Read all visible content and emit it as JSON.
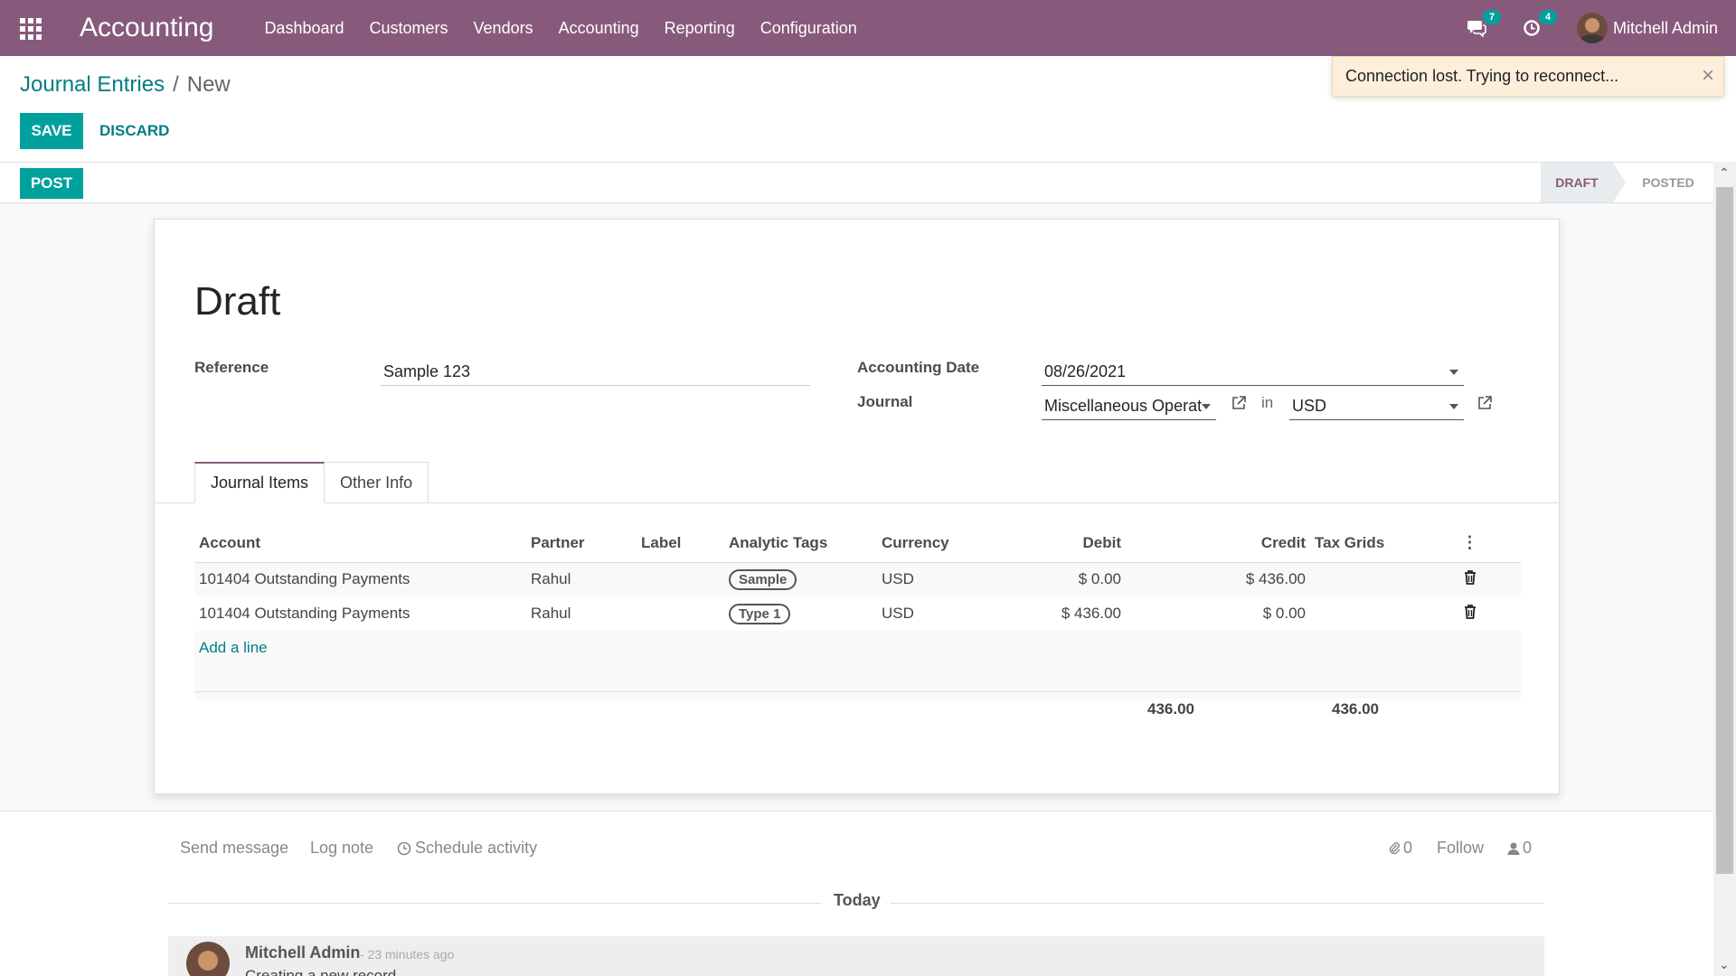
{
  "navbar": {
    "app_name": "Accounting",
    "menu": [
      "Dashboard",
      "Customers",
      "Vendors",
      "Accounting",
      "Reporting",
      "Configuration"
    ],
    "messages_count": "7",
    "activities_count": "4",
    "user_name": "Mitchell Admin"
  },
  "breadcrumb": {
    "parent": "Journal Entries",
    "separator": "/",
    "current": "New"
  },
  "buttons": {
    "save": "SAVE",
    "discard": "DISCARD",
    "post": "POST"
  },
  "notification": {
    "text": "Connection lost. Trying to reconnect...",
    "close": "×"
  },
  "statusbar": {
    "stages": [
      "DRAFT",
      "POSTED"
    ],
    "active": "DRAFT"
  },
  "form": {
    "title": "Draft",
    "reference_label": "Reference",
    "reference_value": "Sample 123",
    "date_label": "Accounting Date",
    "date_value": "08/26/2021",
    "journal_label": "Journal",
    "journal_value": "Miscellaneous Operat",
    "in_text": "in",
    "currency_value": "USD"
  },
  "tabs": [
    "Journal Items",
    "Other Info"
  ],
  "table": {
    "headers": [
      "Account",
      "Partner",
      "Label",
      "Analytic Tags",
      "Currency",
      "Debit",
      "Credit",
      "Tax Grids"
    ],
    "rows": [
      {
        "account": "101404 Outstanding Payments",
        "partner": "Rahul",
        "label": "",
        "tag": "Sample",
        "currency": "USD",
        "debit": "$ 0.00",
        "credit": "$ 436.00"
      },
      {
        "account": "101404 Outstanding Payments",
        "partner": "Rahul",
        "label": "",
        "tag": "Type 1",
        "currency": "USD",
        "debit": "$ 436.00",
        "credit": "$ 0.00"
      }
    ],
    "add_line": "Add a line",
    "total_debit": "436.00",
    "total_credit": "436.00"
  },
  "chatter": {
    "send_message": "Send message",
    "log_note": "Log note",
    "schedule_activity": "Schedule activity",
    "attachments_count": "0",
    "follow": "Follow",
    "followers_count": "0",
    "date_separator": "Today",
    "message_author": "Mitchell Admin",
    "message_time": "- 23 minutes ago",
    "message_body": "Creating a new record..."
  },
  "colors": {
    "brand": "#875a7b",
    "primary": "#00a09d",
    "link": "#017e84"
  }
}
